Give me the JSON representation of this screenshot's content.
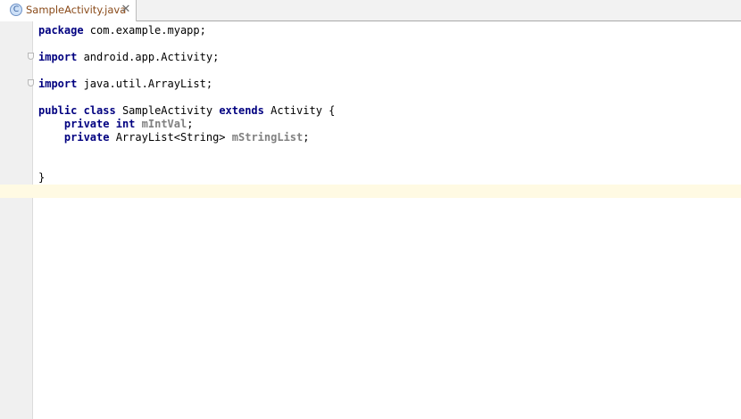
{
  "tab": {
    "icon_letter": "C",
    "title": "SampleActivity.java",
    "close_glyph": "✕"
  },
  "code": {
    "line_package": {
      "kw": "package",
      "rest": " com.example.myapp;"
    },
    "line_import1": {
      "kw": "import",
      "rest": " android.app.Activity;"
    },
    "line_import2": {
      "kw": "import",
      "rest": " java.util.ArrayList;"
    },
    "line_class": {
      "kw1": "public",
      "kw2": "class",
      "name": " SampleActivity ",
      "kw3": "extends",
      "rest": " Activity {"
    },
    "line_field1": {
      "indent": "    ",
      "kw1": "private",
      "kw2": "int",
      "field": "mIntVal",
      "end": ";"
    },
    "line_field2": {
      "indent": "    ",
      "kw1": "private",
      "type": " ArrayList<String> ",
      "field": "mStringList",
      "end": ";"
    },
    "line_close": "}"
  },
  "colors": {
    "keyword": "#000080",
    "field": "#808080",
    "caret_line": "#fffae3",
    "gutter": "#f0f0f0",
    "tab_title": "#8a4b1a"
  }
}
